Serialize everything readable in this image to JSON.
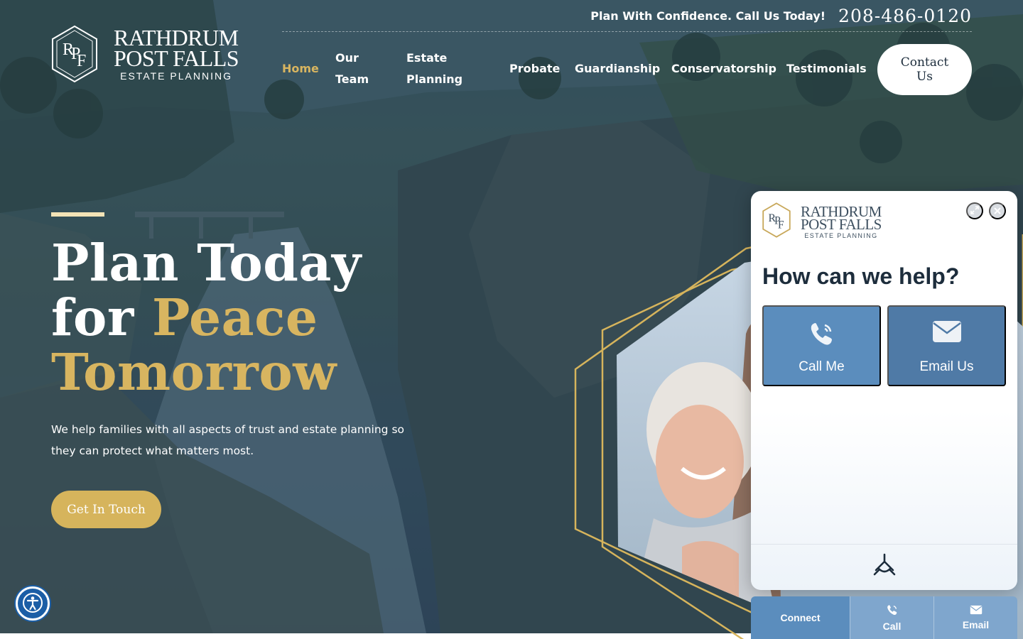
{
  "header": {
    "tagline": "Plan With Confidence. Call Us Today!",
    "phone": "208-486-0120",
    "logo": {
      "line1": "RATHDRUM",
      "line2": "POST FALLS",
      "line3": "ESTATE PLANNING",
      "monogram": "RPF"
    },
    "nav": [
      {
        "label": "Home",
        "active": true
      },
      {
        "label": "Our Team"
      },
      {
        "label": "Estate Planning"
      },
      {
        "label": "Probate"
      },
      {
        "label": "Guardianship"
      },
      {
        "label": "Conservatorship"
      },
      {
        "label": "Testimonials"
      }
    ],
    "contact_label": "Contact Us"
  },
  "hero": {
    "title_line1": "Plan Today",
    "title_line2_a": "for ",
    "title_line2_b": "Peace",
    "title_line3": "Tomorrow",
    "subtitle": "We help families with all aspects of trust and estate planning so they can protect what matters most.",
    "cta_label": "Get In Touch"
  },
  "widget": {
    "heading": "How can we help?",
    "call_label": "Call Me",
    "email_label": "Email Us",
    "expand_icon": "expand-icon",
    "close_icon": "close-icon"
  },
  "bottom_bar": {
    "connect_label": "Connect",
    "call_label": "Call",
    "email_label": "Email"
  },
  "accessibility": {
    "icon": "accessibility-icon"
  },
  "colors": {
    "gold": "#d8b560",
    "cta": "#d6b45c",
    "widget_blue": "#5b8dbd",
    "widget_blue_dark": "#4f7aa6",
    "a11y_blue": "#1b5ea6"
  }
}
